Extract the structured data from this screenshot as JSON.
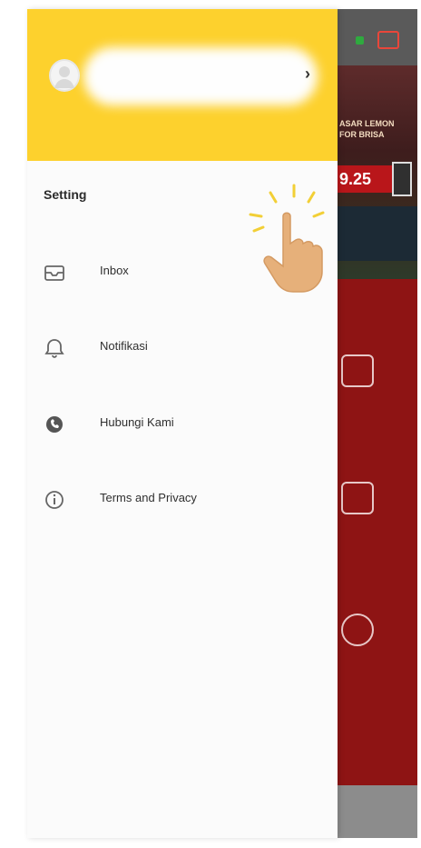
{
  "drawer": {
    "profile": {
      "chevron": "›"
    },
    "section_title": "Setting",
    "items": [
      {
        "label": "Inbox",
        "icon": "inbox-icon"
      },
      {
        "label": "Notifikasi",
        "icon": "bell-icon"
      },
      {
        "label": "Hubungi Kami",
        "icon": "phone-icon"
      },
      {
        "label": "Terms and Privacy",
        "icon": "info-icon"
      }
    ]
  },
  "background_app": {
    "banner_text": "ASAR LEMON\nFOR BRISA",
    "banner_price": "9.25"
  },
  "colors": {
    "header_yellow": "#fdd12d",
    "app_red": "#8e1414",
    "drawer_bg": "#fbfbfb"
  }
}
